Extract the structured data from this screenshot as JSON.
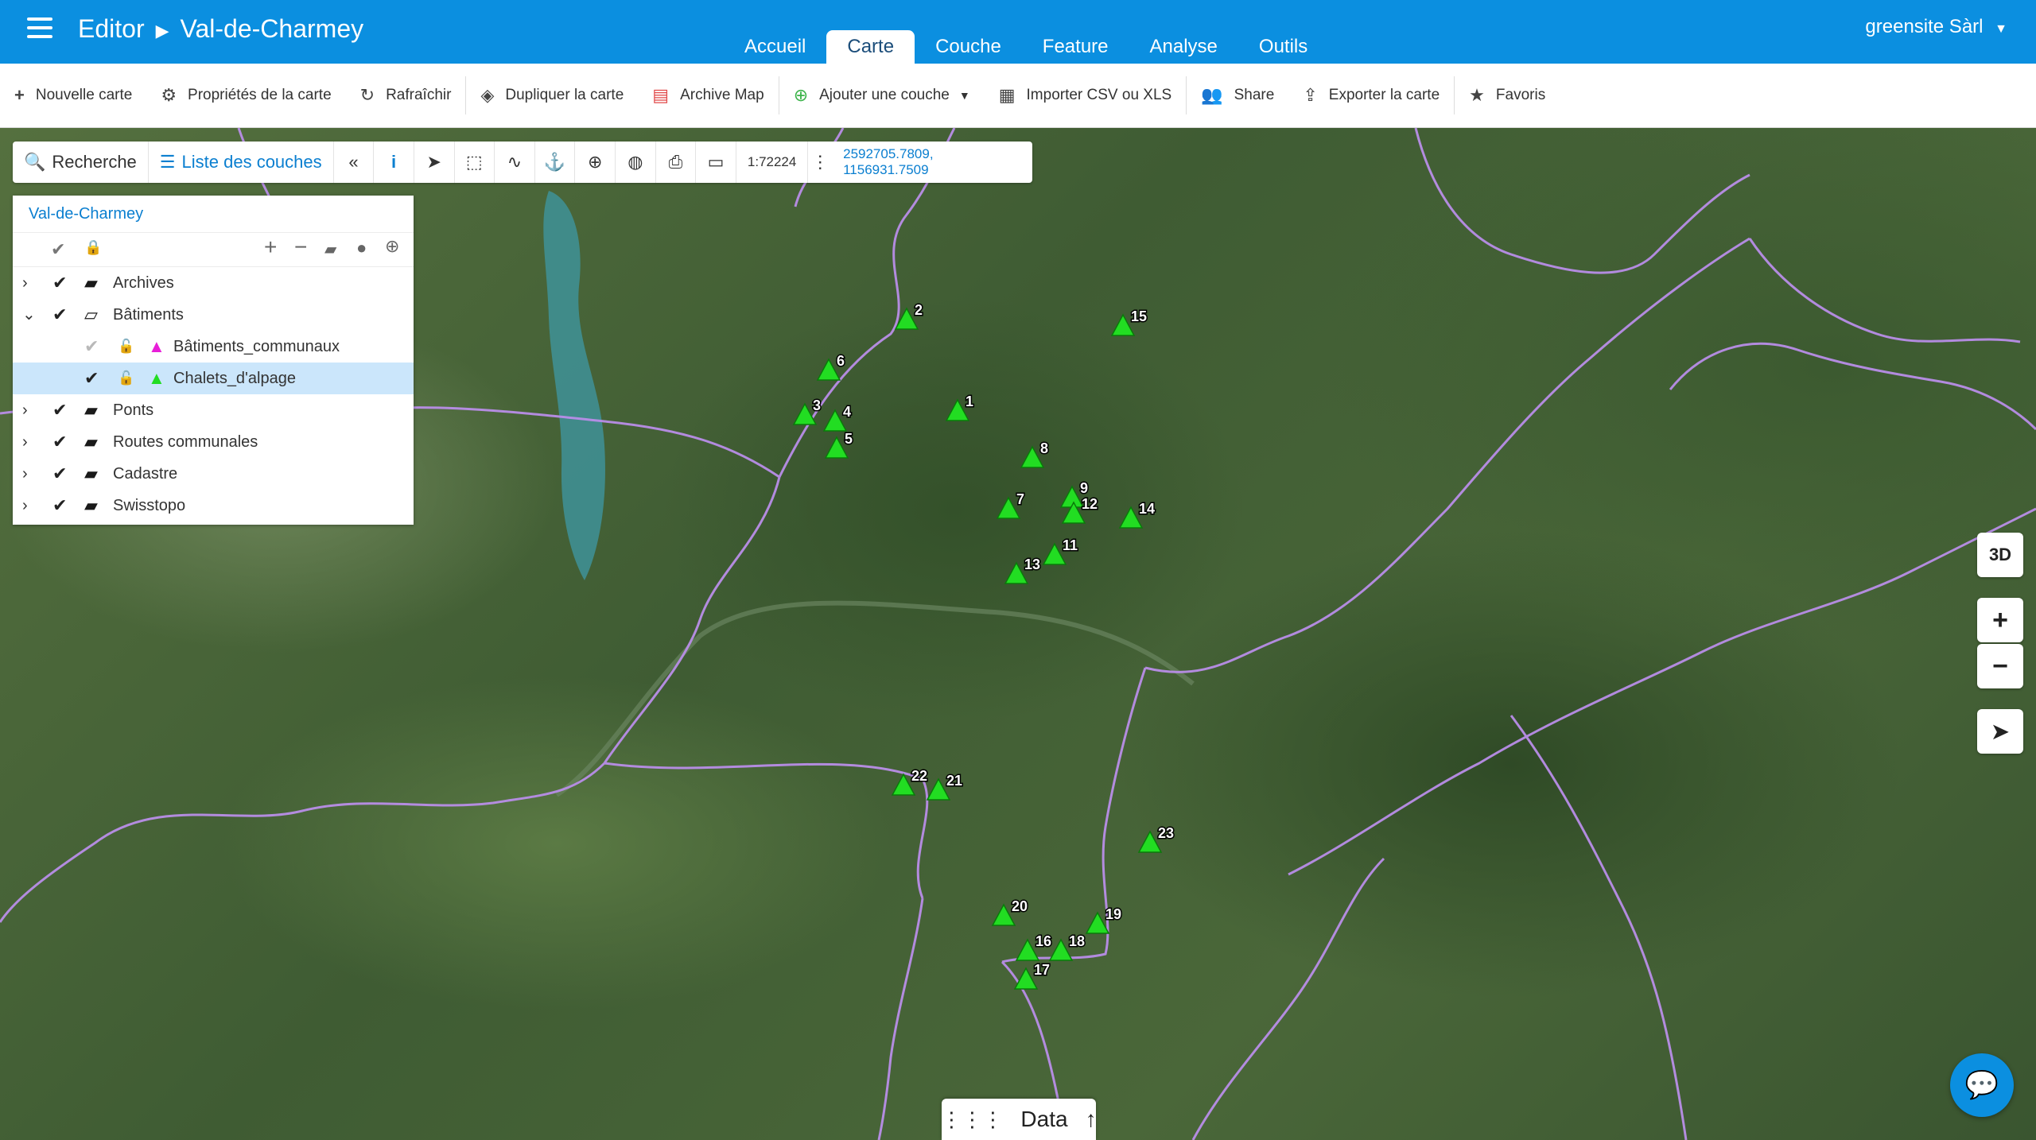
{
  "header": {
    "app": "Editor",
    "map_name": "Val-de-Charmey",
    "tabs": [
      {
        "label": "Accueil",
        "active": false
      },
      {
        "label": "Carte",
        "active": true
      },
      {
        "label": "Couche",
        "active": false
      },
      {
        "label": "Feature",
        "active": false
      },
      {
        "label": "Analyse",
        "active": false
      },
      {
        "label": "Outils",
        "active": false
      }
    ],
    "user": "greensite Sàrl"
  },
  "toolbar": {
    "new_map": "Nouvelle carte",
    "map_props": "Propriétés de la carte",
    "refresh": "Rafraîchir",
    "duplicate": "Dupliquer la carte",
    "archive": "Archive Map",
    "add_layer": "Ajouter une couche",
    "import": "Importer CSV ou XLS",
    "share": "Share",
    "export": "Exporter la carte",
    "favorites": "Favoris"
  },
  "map_tools": {
    "search": "Recherche",
    "layer_list": "Liste des couches",
    "scale": "1:72224",
    "coordinates": "2592705.7809, 1156931.7509"
  },
  "layer_panel": {
    "title": "Val-de-Charmey",
    "layers": [
      {
        "name": "Archives",
        "type": "folder",
        "expanded": false,
        "checked": true
      },
      {
        "name": "Bâtiments",
        "type": "folder-open",
        "expanded": true,
        "checked": true
      },
      {
        "name": "Bâtiments_communaux",
        "type": "layer",
        "checked": false,
        "symbol_color": "#e81ed8"
      },
      {
        "name": "Chalets_d'alpage",
        "type": "layer",
        "checked": true,
        "symbol_color": "#22dd22",
        "selected": true
      },
      {
        "name": "Ponts",
        "type": "folder",
        "expanded": false,
        "checked": true
      },
      {
        "name": "Routes communales",
        "type": "folder",
        "expanded": false,
        "checked": true
      },
      {
        "name": "Cadastre",
        "type": "folder",
        "expanded": false,
        "checked": true
      },
      {
        "name": "Swisstopo",
        "type": "folder",
        "expanded": false,
        "checked": true
      }
    ]
  },
  "map_controls": {
    "three_d": "3D",
    "zoom_in": "+",
    "zoom_out": "−"
  },
  "data_panel": {
    "label": "Data"
  },
  "markers": [
    "1",
    "2",
    "3",
    "4",
    "5",
    "6",
    "7",
    "8",
    "9",
    "11",
    "12",
    "13",
    "14",
    "15",
    "16",
    "17",
    "18",
    "19",
    "20",
    "21",
    "22",
    "23"
  ],
  "colors": {
    "brand": "#0b8fe0",
    "marker": "#22dd22",
    "boundary": "#b98ee8"
  }
}
